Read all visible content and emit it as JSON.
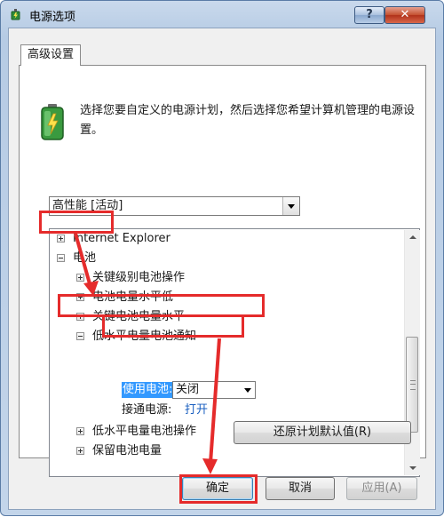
{
  "window": {
    "title": "电源选项",
    "help_label": "?",
    "close_label": "✕"
  },
  "tab": {
    "label": "高级设置"
  },
  "description": "选择您要自定义的电源计划，然后选择您希望计算机管理的电源设置。",
  "plan_select": {
    "value": "高性能 [活动]"
  },
  "tree": {
    "items": [
      {
        "label": "Internet Explorer",
        "expanded": false
      },
      {
        "label": "电池",
        "expanded": true
      },
      {
        "label": "关键级别电池操作",
        "expanded": false
      },
      {
        "label": "电池电量水平低",
        "expanded": false
      },
      {
        "label": "关键电池电量水平",
        "expanded": false
      },
      {
        "label": "低水平电量电池通知",
        "expanded": true
      },
      {
        "label": "低水平电量电池操作",
        "expanded": false
      },
      {
        "label": "保留电池电量",
        "expanded": false
      }
    ],
    "on_battery_label": "使用电池:",
    "on_battery_value": "关闭",
    "plugged_in_label": "接通电源:",
    "plugged_in_value": "打开"
  },
  "buttons": {
    "restore_defaults": "还原计划默认值(R)",
    "ok": "确定",
    "cancel": "取消",
    "apply": "应用(A)"
  },
  "colors": {
    "highlight_red": "#e52b2b",
    "selection_blue": "#3399ff",
    "link_blue": "#1a5fc0"
  }
}
